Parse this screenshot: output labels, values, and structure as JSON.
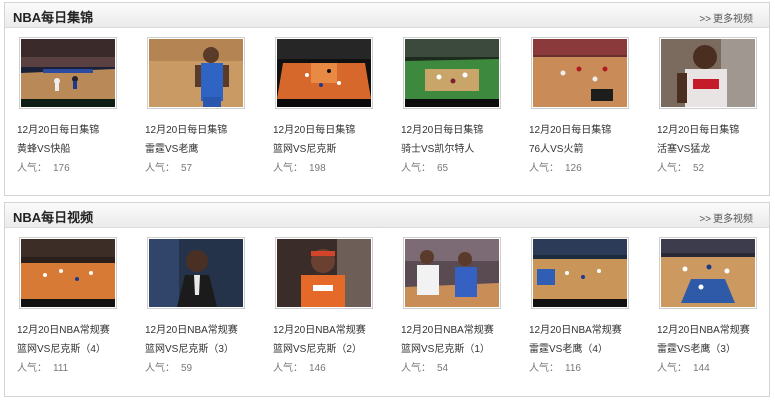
{
  "sections": [
    {
      "title": "NBA每日集锦",
      "more": "更多视频",
      "items": [
        {
          "line1": "12月20日每日集锦",
          "line2": "黄蜂VS快船",
          "pop_label": "人气：",
          "pop_value": "176"
        },
        {
          "line1": "12月20日每日集锦",
          "line2": "雷霆VS老鹰",
          "pop_label": "人气：",
          "pop_value": "57"
        },
        {
          "line1": "12月20日每日集锦",
          "line2": "篮网VS尼克斯",
          "pop_label": "人气：",
          "pop_value": "198"
        },
        {
          "line1": "12月20日每日集锦",
          "line2": "骑士VS凯尔特人",
          "pop_label": "人气：",
          "pop_value": "65"
        },
        {
          "line1": "12月20日每日集锦",
          "line2": "76人VS火箭",
          "pop_label": "人气：",
          "pop_value": "126"
        },
        {
          "line1": "12月20日每日集锦",
          "line2": "活塞VS猛龙",
          "pop_label": "人气：",
          "pop_value": "52"
        }
      ]
    },
    {
      "title": "NBA每日视频",
      "more": "更多视频",
      "items": [
        {
          "line1": "12月20日NBA常规赛",
          "line2": "篮网VS尼克斯（4）",
          "pop_label": "人气：",
          "pop_value": "111"
        },
        {
          "line1": "12月20日NBA常规赛",
          "line2": "篮网VS尼克斯（3）",
          "pop_label": "人气：",
          "pop_value": "59"
        },
        {
          "line1": "12月20日NBA常规赛",
          "line2": "篮网VS尼克斯（2）",
          "pop_label": "人气：",
          "pop_value": "146"
        },
        {
          "line1": "12月20日NBA常规赛",
          "line2": "篮网VS尼克斯（1）",
          "pop_label": "人气：",
          "pop_value": "54"
        },
        {
          "line1": "12月20日NBA常规赛",
          "line2": "雷霆VS老鹰（4）",
          "pop_label": "人气：",
          "pop_value": "116"
        },
        {
          "line1": "12月20日NBA常规赛",
          "line2": "雷霆VS老鹰（3）",
          "pop_label": "人气：",
          "pop_value": "144"
        }
      ]
    }
  ]
}
